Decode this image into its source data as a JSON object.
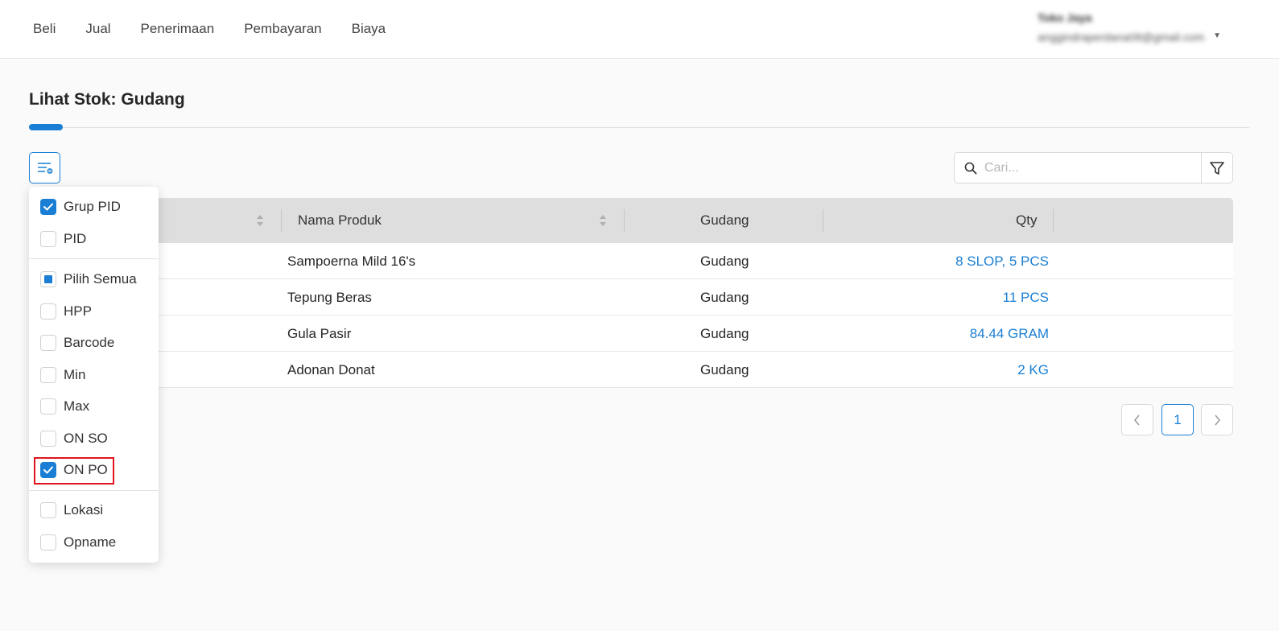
{
  "nav": {
    "items": [
      "Beli",
      "Jual",
      "Penerimaan",
      "Pembayaran",
      "Biaya"
    ]
  },
  "user": {
    "name": "Toko Jaya",
    "email": "anggindraperdana08@gmail.com"
  },
  "page": {
    "title": "Lihat Stok: Gudang"
  },
  "search": {
    "placeholder": "Cari..."
  },
  "table": {
    "headers": {
      "nama_produk": "Nama Produk",
      "gudang": "Gudang",
      "qty": "Qty"
    },
    "rows": [
      {
        "nama": "Sampoerna Mild 16's",
        "gudang": "Gudang",
        "qty": "8 SLOP, 5 PCS"
      },
      {
        "nama": "Tepung Beras",
        "gudang": "Gudang",
        "qty": "11 PCS"
      },
      {
        "nama": "Gula Pasir",
        "gudang": "Gudang",
        "qty": "84.44 GRAM"
      },
      {
        "nama": "Adonan Donat",
        "gudang": "Gudang",
        "qty": "2 KG"
      }
    ]
  },
  "pagination": {
    "current": "1"
  },
  "columns_menu": {
    "items": [
      {
        "label": "Grup PID",
        "state": "checked"
      },
      {
        "label": "PID",
        "state": "unchecked"
      },
      {
        "label": "Pilih Semua",
        "state": "indeterminate"
      },
      {
        "label": "HPP",
        "state": "unchecked"
      },
      {
        "label": "Barcode",
        "state": "unchecked"
      },
      {
        "label": "Min",
        "state": "unchecked"
      },
      {
        "label": "Max",
        "state": "unchecked"
      },
      {
        "label": "ON SO",
        "state": "unchecked"
      },
      {
        "label": "ON PO",
        "state": "checked"
      },
      {
        "label": "Lokasi",
        "state": "unchecked"
      },
      {
        "label": "Opname",
        "state": "unchecked"
      }
    ]
  },
  "colors": {
    "accent": "#1a7fd4",
    "highlight": "#e0141e"
  }
}
